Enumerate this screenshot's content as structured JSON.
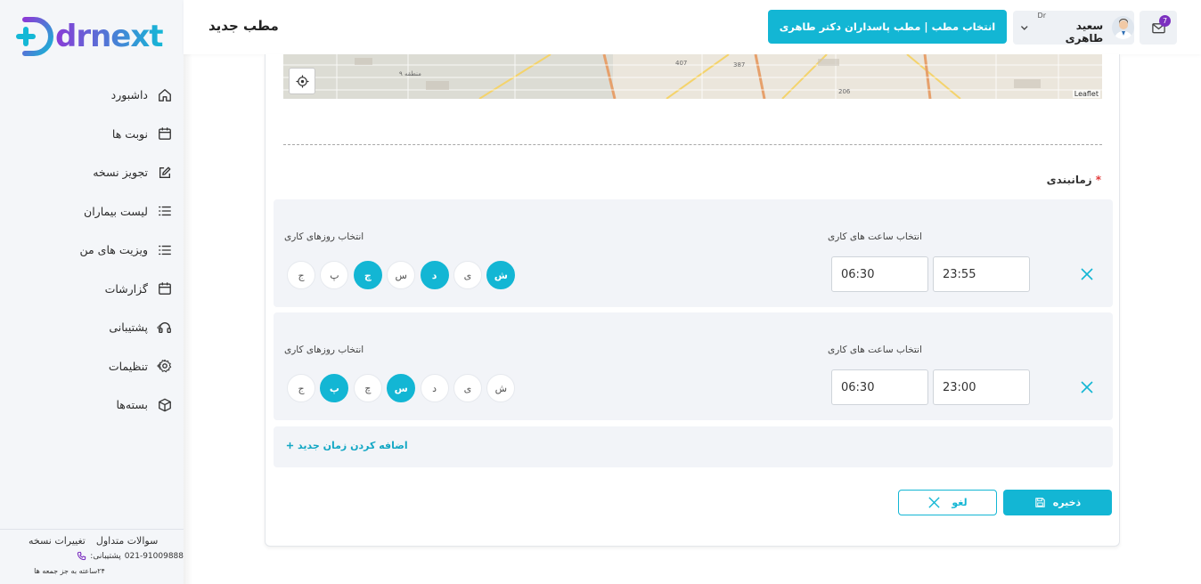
{
  "brand": {
    "logo_text": "drnext",
    "accent": "#13b6d4",
    "brand_purple": "#7b2fbf"
  },
  "sidebar": {
    "items": [
      {
        "label": "داشبورد",
        "icon": "home-icon"
      },
      {
        "label": "نوبت ها",
        "icon": "calendar-icon"
      },
      {
        "label": "تجویز نسخه",
        "icon": "edit-icon"
      },
      {
        "label": "لیست بیماران",
        "icon": "list-icon"
      },
      {
        "label": "ویزیت های من",
        "icon": "list-icon"
      },
      {
        "label": "گزارشات",
        "icon": "calendar-icon"
      },
      {
        "label": "پشتیبانی",
        "icon": "headphones-icon"
      },
      {
        "label": "تنظیمات",
        "icon": "gear-icon"
      },
      {
        "label": "بسته‌ها",
        "icon": "box-icon"
      }
    ],
    "footer": {
      "faq": "سوالات متداول",
      "changes": "تغییرات نسخه",
      "phone": "021-91009888",
      "phone_label": ":پشتیبانی",
      "hours": "۲۴ساعته به جز جمعه ها"
    }
  },
  "header": {
    "title": "مطب جدید",
    "clinic_button": "انتخاب مطب | مطب پاسداران دکتر طاهری",
    "user_prefix": "Dr",
    "user_name": "سعید طاهری",
    "messages_count": "7"
  },
  "map": {
    "attribution": "Leaflet",
    "labels": [
      "منطقه ۹",
      "407",
      "387",
      "206"
    ]
  },
  "schedule": {
    "title": "زمانبندی",
    "required_mark": "*",
    "rows": [
      {
        "days_label": "انتخاب روزهای کاری",
        "hours_label": "انتخاب ساعت های کاری",
        "start": "06:30",
        "end": "23:55",
        "days": [
          {
            "label": "ش",
            "active": true
          },
          {
            "label": "ی",
            "active": false
          },
          {
            "label": "د",
            "active": true
          },
          {
            "label": "س",
            "active": false
          },
          {
            "label": "چ",
            "active": true
          },
          {
            "label": "پ",
            "active": false
          },
          {
            "label": "ج",
            "active": false
          }
        ]
      },
      {
        "days_label": "انتخاب روزهای کاری",
        "hours_label": "انتخاب ساعت های کاری",
        "start": "06:30",
        "end": "23:00",
        "days": [
          {
            "label": "ش",
            "active": false
          },
          {
            "label": "ی",
            "active": false
          },
          {
            "label": "د",
            "active": false
          },
          {
            "label": "س",
            "active": true
          },
          {
            "label": "چ",
            "active": false
          },
          {
            "label": "پ",
            "active": true
          },
          {
            "label": "ج",
            "active": false
          }
        ]
      }
    ],
    "add_label": "اضافه کردن زمان جدید"
  },
  "actions": {
    "save": "ذخیره",
    "cancel": "لغو"
  }
}
